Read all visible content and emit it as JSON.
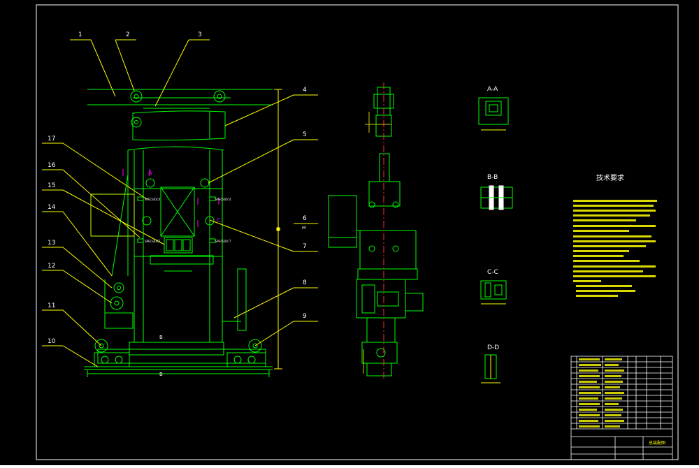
{
  "drawing": {
    "balloons": [
      "1",
      "2",
      "3",
      "4",
      "5",
      "6",
      "7",
      "8",
      "9",
      "10",
      "11",
      "12",
      "13",
      "14",
      "15",
      "16",
      "17"
    ],
    "section_titles": {
      "aa": "A-A",
      "bb": "B-B",
      "cc": "C-C",
      "dd": "D-D"
    },
    "view_markers": {
      "a": "A",
      "c": "C",
      "b_dim": "B",
      "b_marker": "B",
      "h": "H"
    },
    "plate_labels": [
      "SPECS/DC4",
      "SPECS/DC4",
      "SPECS/DCT",
      "SPECS/DCT"
    ],
    "tech_requirements": {
      "title": "技术要求"
    }
  },
  "title_block": {
    "drawing_name": "总装配图"
  },
  "colors": {
    "background": "#000000",
    "frame": "#ffffff",
    "structure": "#00ff00",
    "leader": "#ffff00",
    "annotation": "#ff00ff",
    "centerline": "#ff3030",
    "text": "#ffffff"
  }
}
